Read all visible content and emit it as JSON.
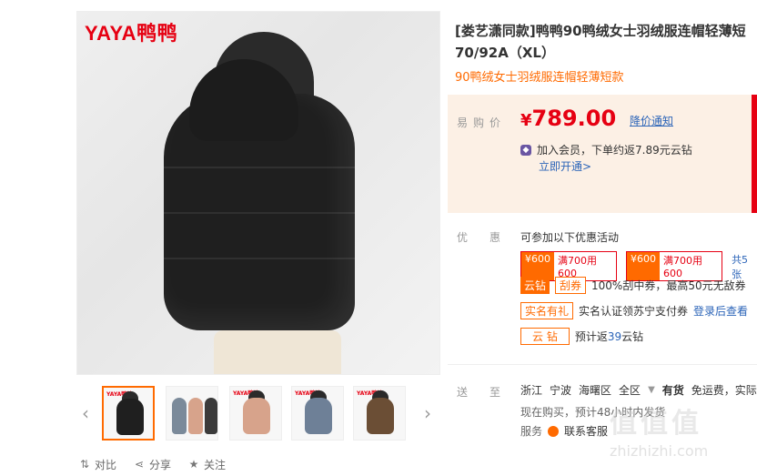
{
  "brand": {
    "logo_text": "YAYA鸭鸭"
  },
  "gallery": {
    "thumbnails": [
      {
        "label": "thumb-1",
        "color": "#1f1f1f",
        "active": true
      },
      {
        "label": "thumb-2",
        "color": "#7b8a9a"
      },
      {
        "label": "thumb-3",
        "color": "#d7a38b"
      },
      {
        "label": "thumb-4",
        "color": "#6e8097"
      },
      {
        "label": "thumb-5",
        "color": "#6b4e35"
      }
    ]
  },
  "actions": {
    "compare": "对比",
    "share": "分享",
    "follow": "关注"
  },
  "product": {
    "title_line1": "[娄艺潇同款]鸭鸭90鸭绒女士羽绒服连帽轻薄短",
    "title_line2": "70/92A（XL）",
    "subtitle": "90鸭绒女士羽绒服连帽轻薄短款"
  },
  "price": {
    "label": "易购价",
    "yen": "¥",
    "value": "789.00",
    "notify_label": "降价通知",
    "member_text": "加入会员，下单约返7.89元云钻",
    "member_link": "立即开通>"
  },
  "promotions": {
    "label": "优惠",
    "intro": "可参加以下优惠活动",
    "coupons": [
      {
        "amount": "¥600",
        "condition": "满700用600"
      },
      {
        "amount": "¥600",
        "condition": "满700用600"
      }
    ],
    "coupons_total": "共5张",
    "cloud_coin_tag": "云钻",
    "scratch_tag": "刮券",
    "scratch_text": "100%刮中券，最高50元无敌券",
    "verify_tag": "实名有礼",
    "verify_text": "实名认证领苏宁支付券",
    "verify_link": "登录后查看",
    "yunzuan_tag": "云 钻",
    "yunzuan_text_prefix": "预计返",
    "yunzuan_num": "39",
    "yunzuan_text_suffix": "云钻"
  },
  "shipping": {
    "label": "送至",
    "province": "浙江",
    "city": "宁波",
    "district": "海曙区",
    "area": "全区",
    "stock": "有货",
    "freight": "免运费，实际",
    "note": "现在购买，预计48小时内发货",
    "service_label": "服务",
    "service_text": "联系客服"
  },
  "watermark": {
    "main": "值值值",
    "sub": "zhizhizhi.com"
  }
}
